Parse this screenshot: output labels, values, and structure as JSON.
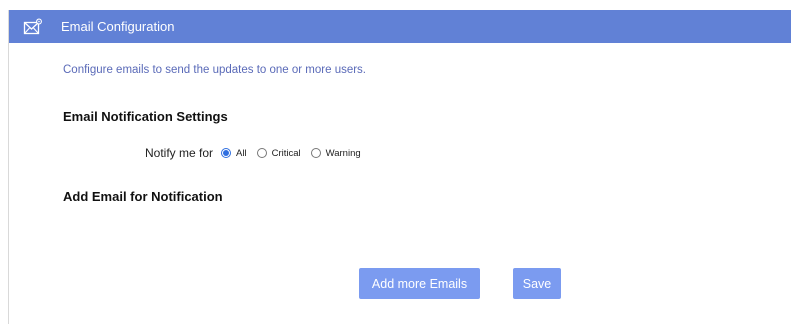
{
  "header": {
    "icon": "email-settings-icon",
    "title": "Email Configuration",
    "color": "#6181d6"
  },
  "intro_text": "Configure emails to send the updates to one or more users.",
  "notification_settings": {
    "title": "Email Notification Settings",
    "notify_label": "Notify me for",
    "options": [
      {
        "label": "All",
        "selected": true
      },
      {
        "label": "Critical",
        "selected": false
      },
      {
        "label": "Warning",
        "selected": false
      }
    ]
  },
  "add_email": {
    "title": "Add Email for Notification"
  },
  "buttons": {
    "add_more_label": "Add more Emails",
    "save_label": "Save",
    "color": "#7b9bf0"
  }
}
